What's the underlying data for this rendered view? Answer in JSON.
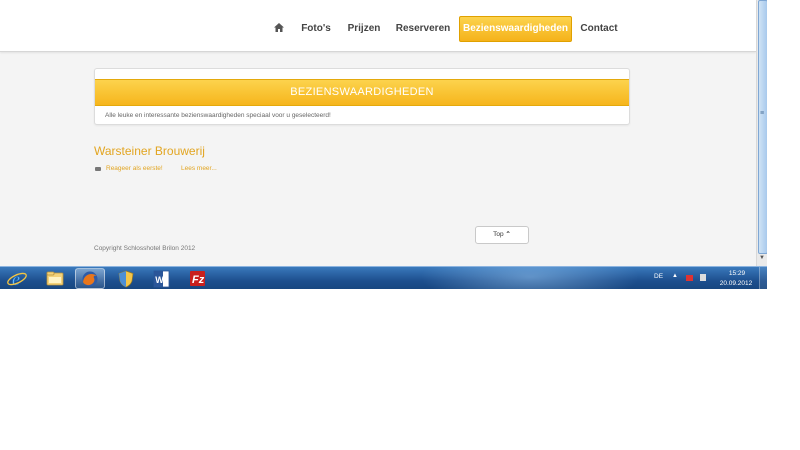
{
  "nav": {
    "home_icon": "home-icon",
    "items": [
      "Foto's",
      "Prijzen",
      "Reserveren",
      "Bezienswaardigheden",
      "Contact"
    ],
    "active": "Bezienswaardigheden"
  },
  "panel": {
    "title": "BEZIENSWAARDIGHEDEN",
    "subtitle": "Alle leuke en interessante bezienswaardigheden speciaal voor u geselecteerd!"
  },
  "article": {
    "title": "Warsteiner Brouwerij",
    "comment_link": "Reageer als eerste!",
    "readmore_link": "Lees meer..."
  },
  "footer": {
    "copyright": "Copyright Schlosshotel Brilon 2012",
    "top_button": "Top"
  },
  "taskbar": {
    "apps": [
      "internet-explorer-icon",
      "file-explorer-icon",
      "firefox-icon",
      "security-shield-icon",
      "word-icon",
      "filezilla-icon"
    ],
    "language": "DE",
    "time": "15:29",
    "date": "20.09.2012"
  },
  "colors": {
    "accent": "#f7b928",
    "accent_text": "#e2a521",
    "taskbar": "#1d4f8e"
  }
}
